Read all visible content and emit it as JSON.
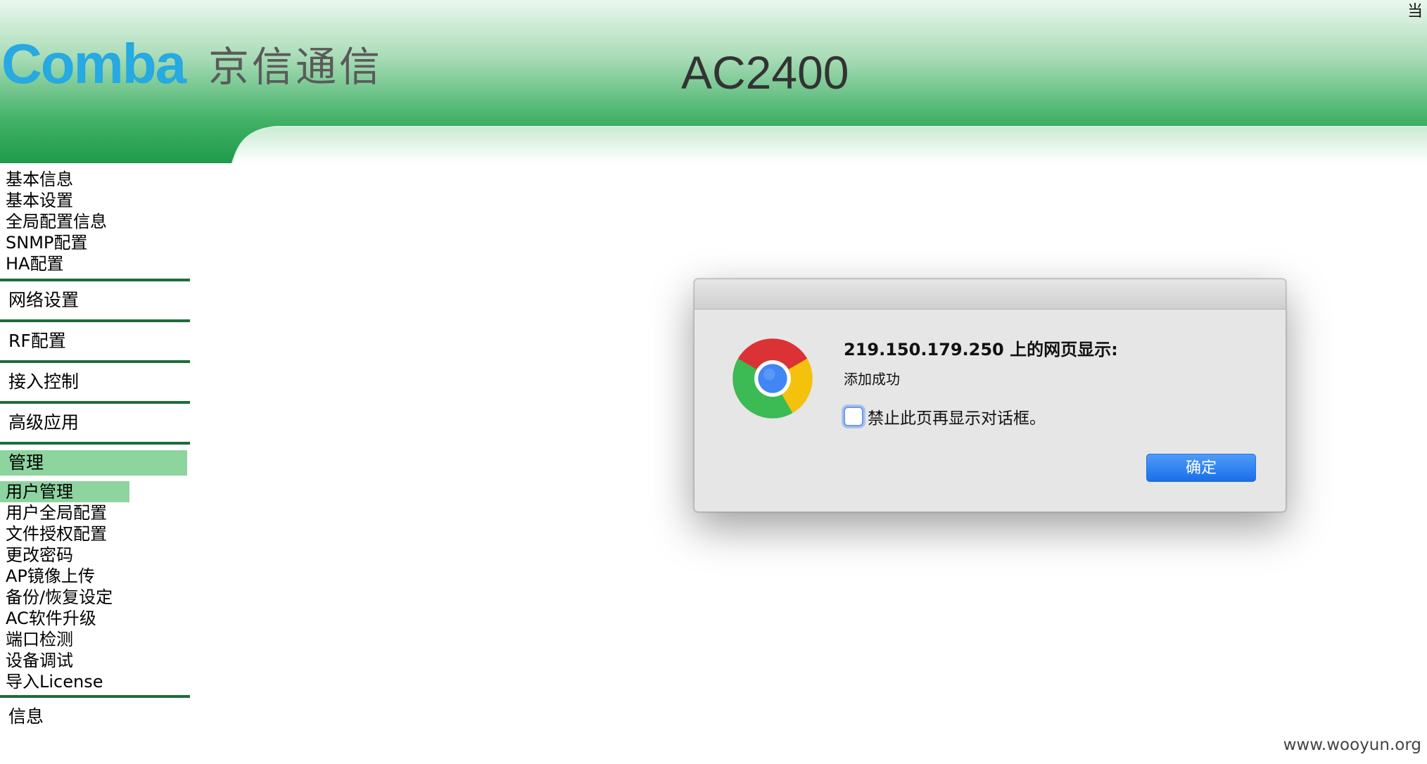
{
  "header": {
    "brand_logo": "Comba",
    "brand_cn": "京信通信",
    "product_title": "AC2400",
    "corner_text": "当"
  },
  "sidebar": {
    "basic_items": [
      {
        "label": "基本信息"
      },
      {
        "label": "基本设置"
      },
      {
        "label": "全局配置信息"
      },
      {
        "label": "SNMP配置"
      },
      {
        "label": "HA配置"
      }
    ],
    "sections": [
      {
        "label": "网络设置"
      },
      {
        "label": "RF配置"
      },
      {
        "label": "接入控制"
      },
      {
        "label": "高级应用"
      }
    ],
    "active_section": {
      "label": "管理"
    },
    "management_items": [
      {
        "label": "用户管理",
        "active": true
      },
      {
        "label": "用户全局配置"
      },
      {
        "label": "文件授权配置"
      },
      {
        "label": "更改密码"
      },
      {
        "label": "AP镜像上传"
      },
      {
        "label": "备份/恢复设定"
      },
      {
        "label": "AC软件升级"
      },
      {
        "label": "端口检测"
      },
      {
        "label": "设备调试"
      },
      {
        "label": "导入License"
      }
    ],
    "last_section": {
      "label": "信息"
    }
  },
  "dialog": {
    "heading": "219.150.179.250 上的网页显示:",
    "message": "添加成功",
    "suppress_label": "禁止此页再显示对话框。",
    "suppress_checked": false,
    "ok_label": "确定"
  },
  "watermark": "www.wooyun.org",
  "colors": {
    "header_green": "#1f9a4b",
    "header_light": "#e8f6ec",
    "brand_blue": "#27a9e1",
    "menu_highlight": "#8ed49f",
    "separator": "#1d6e3a",
    "button_blue": "#1a6fe8"
  }
}
